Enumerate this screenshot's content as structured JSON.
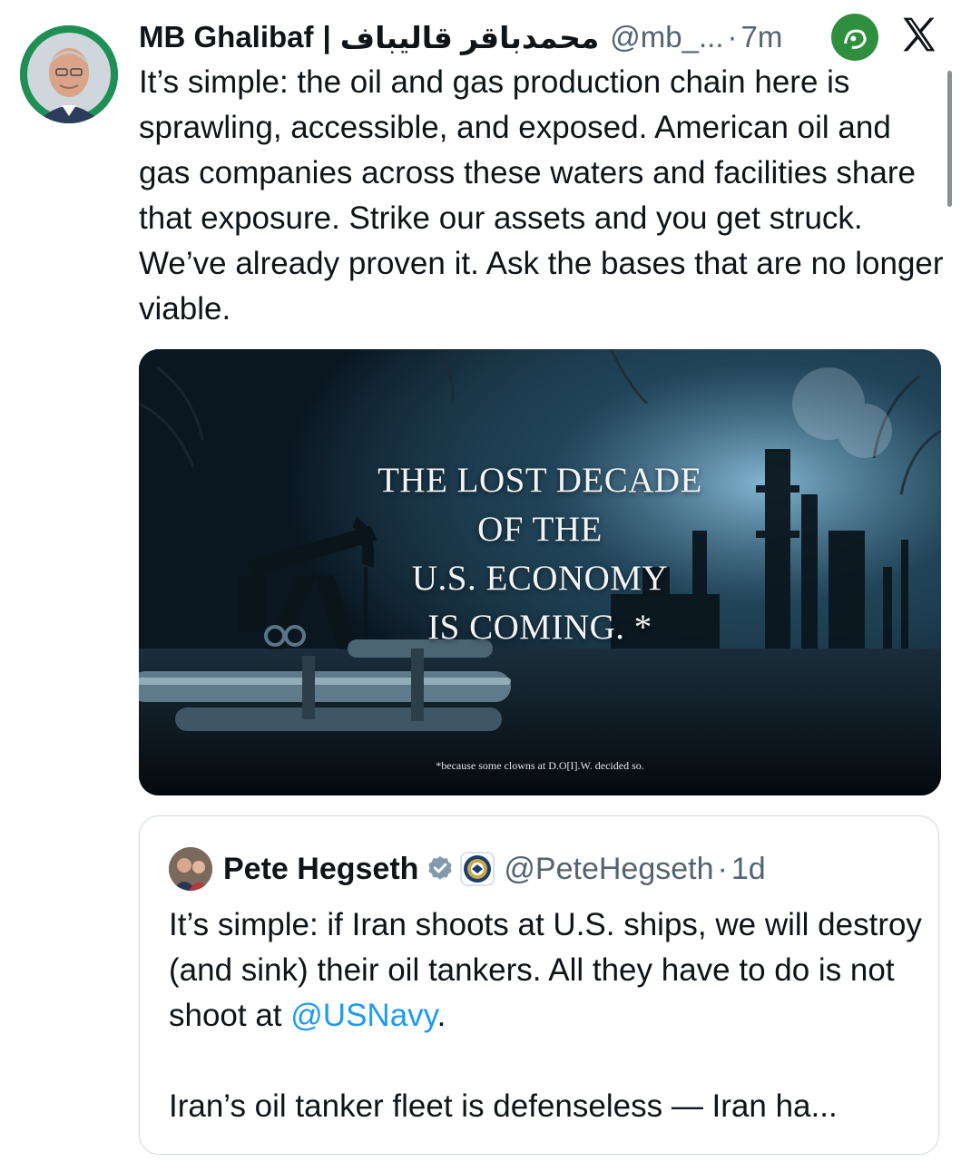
{
  "tweet": {
    "author_name": "MB Ghalibaf",
    "author_separator": "|",
    "author_name_fa": "محمدباقر قالیباف",
    "handle": "@mb_...",
    "dot": "·",
    "time": "7m",
    "text": "It’s simple: the oil and gas production chain here is sprawling, accessible, and exposed. American oil and gas companies across these waters and facilities share that exposure. Strike our assets and you get struck. We’ve already proven it. Ask the bases that are no longer viable."
  },
  "media": {
    "headline_lines": [
      "THE LOST DECADE",
      "OF THE",
      "U.S. ECONOMY",
      "IS COMING. *"
    ],
    "footnote": "*because some clowns at D.O[I].W. decided so."
  },
  "quote": {
    "author_name": "Pete Hegseth",
    "handle": "@PeteHegseth",
    "dot": "·",
    "time": "1d",
    "text_part1": "It’s simple: if Iran shoots at U.S. ships, we will destroy (and sink) their oil tankers. All they have to do is not shoot at ",
    "mention": "@USNavy",
    "text_part2": ".",
    "text_para2": "Iran’s oil tanker fleet is defenseless — Iran ha..."
  },
  "icons": {
    "watermark": "news-agency-logo",
    "platform": "x-logo",
    "verified": "verified-badge-icon",
    "seal": "department-seal-icon"
  },
  "colors": {
    "link": "#1d9bf0",
    "secondary_text": "#536471",
    "primary_text": "#0f1419"
  }
}
